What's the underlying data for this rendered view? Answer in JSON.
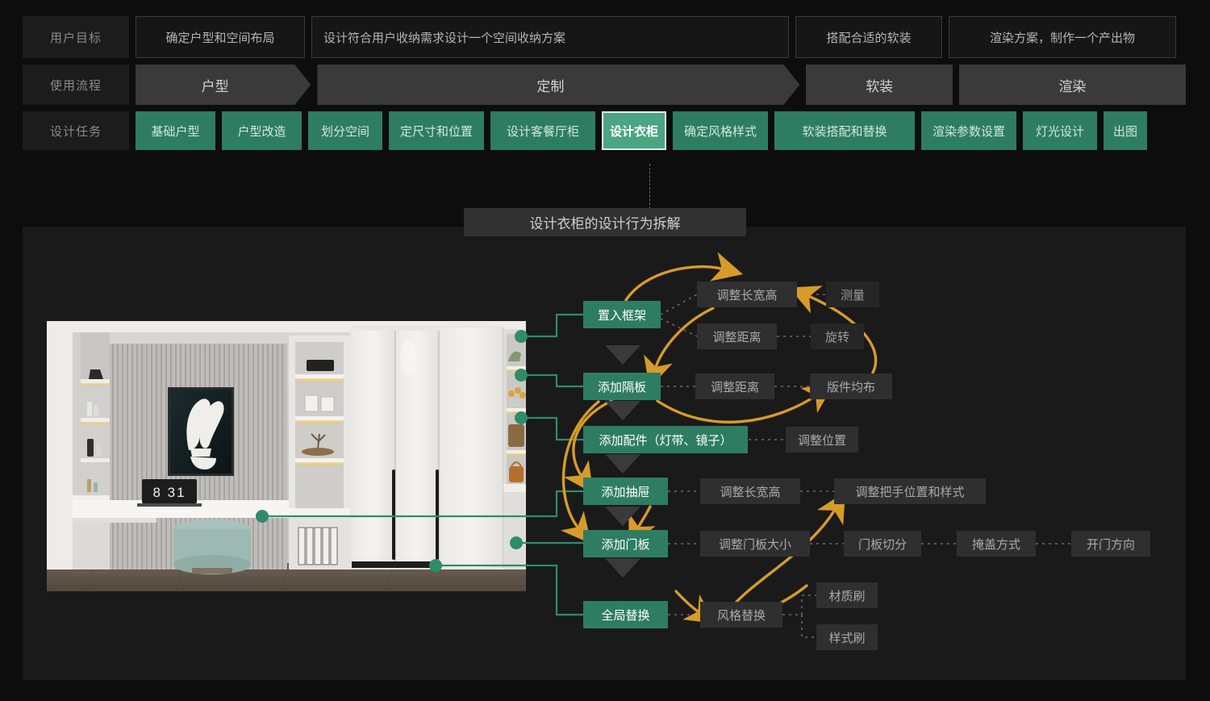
{
  "matrix": {
    "rows": [
      {
        "label": "用户目标",
        "cells": [
          {
            "text": "确定户型和空间布局",
            "align": "center"
          },
          {
            "text": "设计符合用户收纳需求设计一个空间收纳方案",
            "align": "left"
          },
          {
            "text": "搭配合适的软装",
            "align": "center"
          },
          {
            "text": "渲染方案，制作一个产出物",
            "align": "center"
          }
        ]
      },
      {
        "label": "使用流程",
        "cells": [
          {
            "text": "户型",
            "chevron": true
          },
          {
            "text": "定制",
            "chevron": true
          },
          {
            "text": "软装",
            "chevron": false
          },
          {
            "text": "渲染",
            "chevron": false
          }
        ]
      },
      {
        "label": "设计任务",
        "cells": [
          {
            "text": "基础户型",
            "active": false
          },
          {
            "text": "户型改造",
            "active": false
          },
          {
            "text": "划分空间",
            "active": false
          },
          {
            "text": "定尺寸和位置",
            "active": false
          },
          {
            "text": "设计客餐厅柜",
            "active": false
          },
          {
            "text": "设计衣柜",
            "active": true
          },
          {
            "text": "确定风格样式",
            "active": false
          },
          {
            "text": "软装搭配和替换",
            "active": false
          },
          {
            "text": "渲染参数设置",
            "active": false
          },
          {
            "text": "灯光设计",
            "active": false
          },
          {
            "text": "出图",
            "active": false
          }
        ]
      }
    ]
  },
  "caption": "设计衣柜的设计行为拆解",
  "photo": {
    "alt_name": "wardrobe-render-image",
    "clock_label": "8 31"
  },
  "diagram": {
    "steps": [
      {
        "label": "置入框架"
      },
      {
        "label": "添加隔板"
      },
      {
        "label": "添加配件（灯带、镜子）"
      },
      {
        "label": "添加抽屉"
      },
      {
        "label": "添加门板"
      },
      {
        "label": "全局替换"
      }
    ],
    "actions": [
      {
        "label": "调整长宽高"
      },
      {
        "label": "测量"
      },
      {
        "label": "调整距离"
      },
      {
        "label": "旋转"
      },
      {
        "label": "调整距离"
      },
      {
        "label": "版件均布"
      },
      {
        "label": "调整位置"
      },
      {
        "label": "调整长宽高"
      },
      {
        "label": "调整把手位置和样式"
      },
      {
        "label": "调整门板大小"
      },
      {
        "label": "门板切分"
      },
      {
        "label": "掩盖方式"
      },
      {
        "label": "开门方向"
      },
      {
        "label": "风格替换"
      },
      {
        "label": "材质刷"
      },
      {
        "label": "样式刷"
      }
    ]
  },
  "colors": {
    "accent_green": "#2e7d62",
    "accent_green_active": "#4aa583",
    "arrow_gold": "#d79b2a",
    "panel_bg": "#1a1a1a",
    "page_bg": "#0d0d0d",
    "gray_node": "#2f2f2f"
  }
}
